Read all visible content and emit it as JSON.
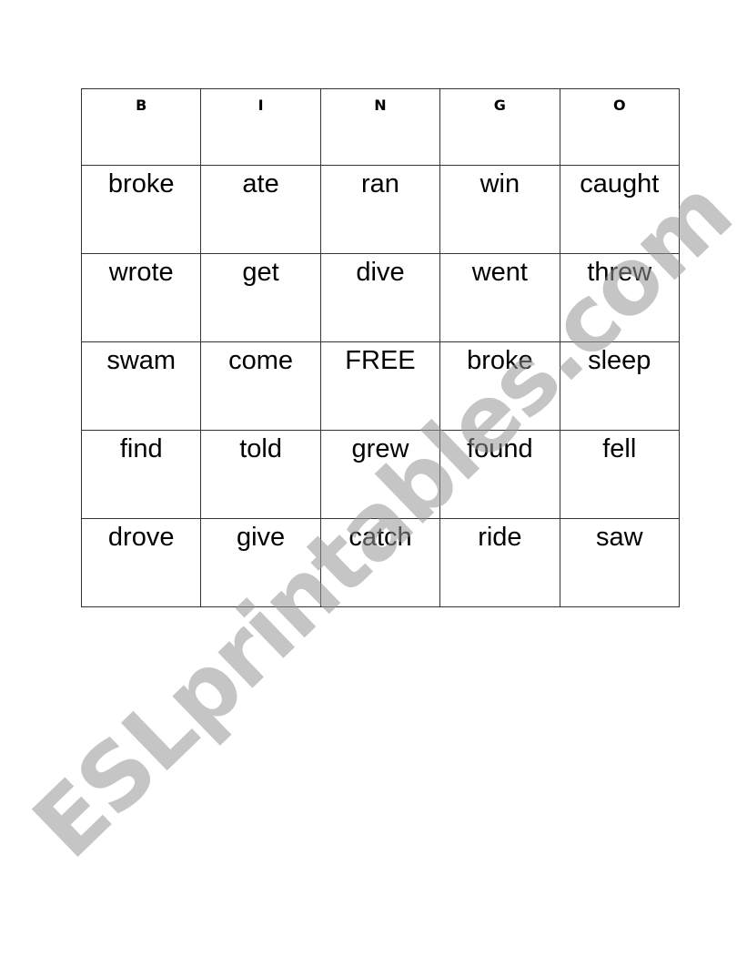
{
  "headers": [
    "B",
    "I",
    "N",
    "G",
    "O"
  ],
  "rows": [
    [
      "broke",
      "ate",
      "ran",
      "win",
      "caught"
    ],
    [
      "wrote",
      "get",
      "dive",
      "went",
      "threw"
    ],
    [
      "swam",
      "come",
      "FREE",
      "broke",
      "sleep"
    ],
    [
      "find",
      "told",
      "grew",
      "found",
      "fell"
    ],
    [
      "drove",
      "give",
      "catch",
      "ride",
      "saw"
    ]
  ],
  "watermark": "ESLprintables.com"
}
